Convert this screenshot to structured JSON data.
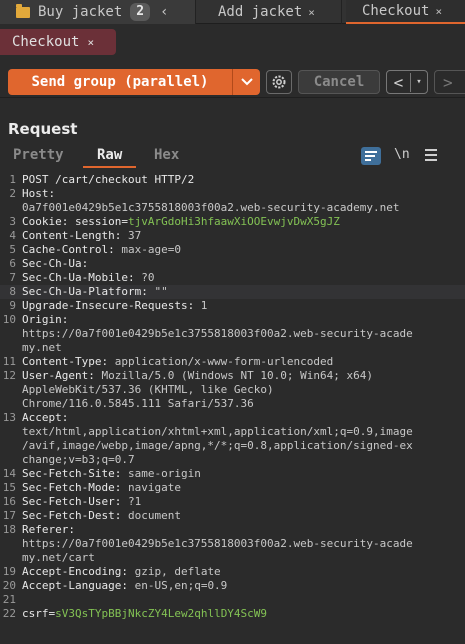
{
  "tabs": {
    "group": {
      "label": "Buy jacket",
      "count": "2",
      "collapse": "‹"
    },
    "add": {
      "label": "Add jacket",
      "close": "×"
    },
    "checkout": {
      "label": "Checkout",
      "close": "×"
    }
  },
  "subtab": {
    "label": "Checkout",
    "close": "×"
  },
  "toolbar": {
    "send_label": "Send group (parallel)",
    "send_dropdown": "⌄",
    "cancel_label": "Cancel",
    "back": "<",
    "back_dropdown": "▾",
    "forward": ">"
  },
  "panel": {
    "title": "Request",
    "tabs": [
      "Pretty",
      "Raw",
      "Hex"
    ],
    "active_tab": "Raw",
    "newline_toggle": "\\n"
  },
  "colors": {
    "accent": "#e0662e",
    "cookie_value": "#83c254",
    "group_tab": "#6b3038"
  },
  "editor": {
    "lines": [
      {
        "n": "1",
        "row": 0,
        "k": "POST /cart/checkout HTTP/2",
        "v": ""
      },
      {
        "n": "2",
        "row": 1,
        "k": "Host:",
        "v": ""
      },
      {
        "n": "",
        "row": 2,
        "k": "",
        "v": "0a7f001e0429b5e1c3755818003f00a2.web-security-academy.net"
      },
      {
        "n": "3",
        "row": 3,
        "k": "Cookie: ",
        "v": "",
        "ck": "session=",
        "cv": "tjvArGdoHi3hfaawXiOOEvwjvDwX5gJZ"
      },
      {
        "n": "4",
        "row": 4,
        "k": "Content-Length:",
        "v": " 37"
      },
      {
        "n": "5",
        "row": 5,
        "k": "Cache-Control:",
        "v": " max-age=0"
      },
      {
        "n": "6",
        "row": 6,
        "k": "Sec-Ch-Ua:",
        "v": ""
      },
      {
        "n": "7",
        "row": 7,
        "k": "Sec-Ch-Ua-Mobile:",
        "v": " ?0"
      },
      {
        "n": "8",
        "row": 8,
        "k": "Sec-Ch-Ua-Platform:",
        "v": " \"\"",
        "hl": true
      },
      {
        "n": "9",
        "row": 9,
        "k": "Upgrade-Insecure-Requests:",
        "v": " 1"
      },
      {
        "n": "10",
        "row": 10,
        "k": "Origin:",
        "v": ""
      },
      {
        "n": "",
        "row": 11,
        "k": "",
        "v": "https://0a7f001e0429b5e1c3755818003f00a2.web-security-acade"
      },
      {
        "n": "",
        "row": 12,
        "k": "",
        "v": "my.net"
      },
      {
        "n": "11",
        "row": 13,
        "k": "Content-Type:",
        "v": " application/x-www-form-urlencoded"
      },
      {
        "n": "12",
        "row": 14,
        "k": "User-Agent:",
        "v": " Mozilla/5.0 (Windows NT 10.0; Win64; x64)"
      },
      {
        "n": "",
        "row": 15,
        "k": "",
        "v": "AppleWebKit/537.36 (KHTML, like Gecko)"
      },
      {
        "n": "",
        "row": 16,
        "k": "",
        "v": "Chrome/116.0.5845.111 Safari/537.36"
      },
      {
        "n": "13",
        "row": 17,
        "k": "Accept:",
        "v": ""
      },
      {
        "n": "",
        "row": 18,
        "k": "",
        "v": "text/html,application/xhtml+xml,application/xml;q=0.9,image"
      },
      {
        "n": "",
        "row": 19,
        "k": "",
        "v": "/avif,image/webp,image/apng,*/*;q=0.8,application/signed-ex"
      },
      {
        "n": "",
        "row": 20,
        "k": "",
        "v": "change;v=b3;q=0.7"
      },
      {
        "n": "14",
        "row": 21,
        "k": "Sec-Fetch-Site:",
        "v": " same-origin"
      },
      {
        "n": "15",
        "row": 22,
        "k": "Sec-Fetch-Mode:",
        "v": " navigate"
      },
      {
        "n": "16",
        "row": 23,
        "k": "Sec-Fetch-User:",
        "v": " ?1"
      },
      {
        "n": "17",
        "row": 24,
        "k": "Sec-Fetch-Dest:",
        "v": " document"
      },
      {
        "n": "18",
        "row": 25,
        "k": "Referer:",
        "v": ""
      },
      {
        "n": "",
        "row": 26,
        "k": "",
        "v": "https://0a7f001e0429b5e1c3755818003f00a2.web-security-acade"
      },
      {
        "n": "",
        "row": 27,
        "k": "",
        "v": "my.net/cart"
      },
      {
        "n": "19",
        "row": 28,
        "k": "Accept-Encoding:",
        "v": " gzip, deflate"
      },
      {
        "n": "20",
        "row": 29,
        "k": "Accept-Language:",
        "v": " en-US,en;q=0.9"
      },
      {
        "n": "21",
        "row": 30,
        "k": "",
        "v": ""
      },
      {
        "n": "22",
        "row": 31,
        "k": "",
        "v": "",
        "ck": "csrf=",
        "cv": "sV3QsTYpBBjNkcZY4Lew2qhllDY4ScW9"
      }
    ]
  }
}
